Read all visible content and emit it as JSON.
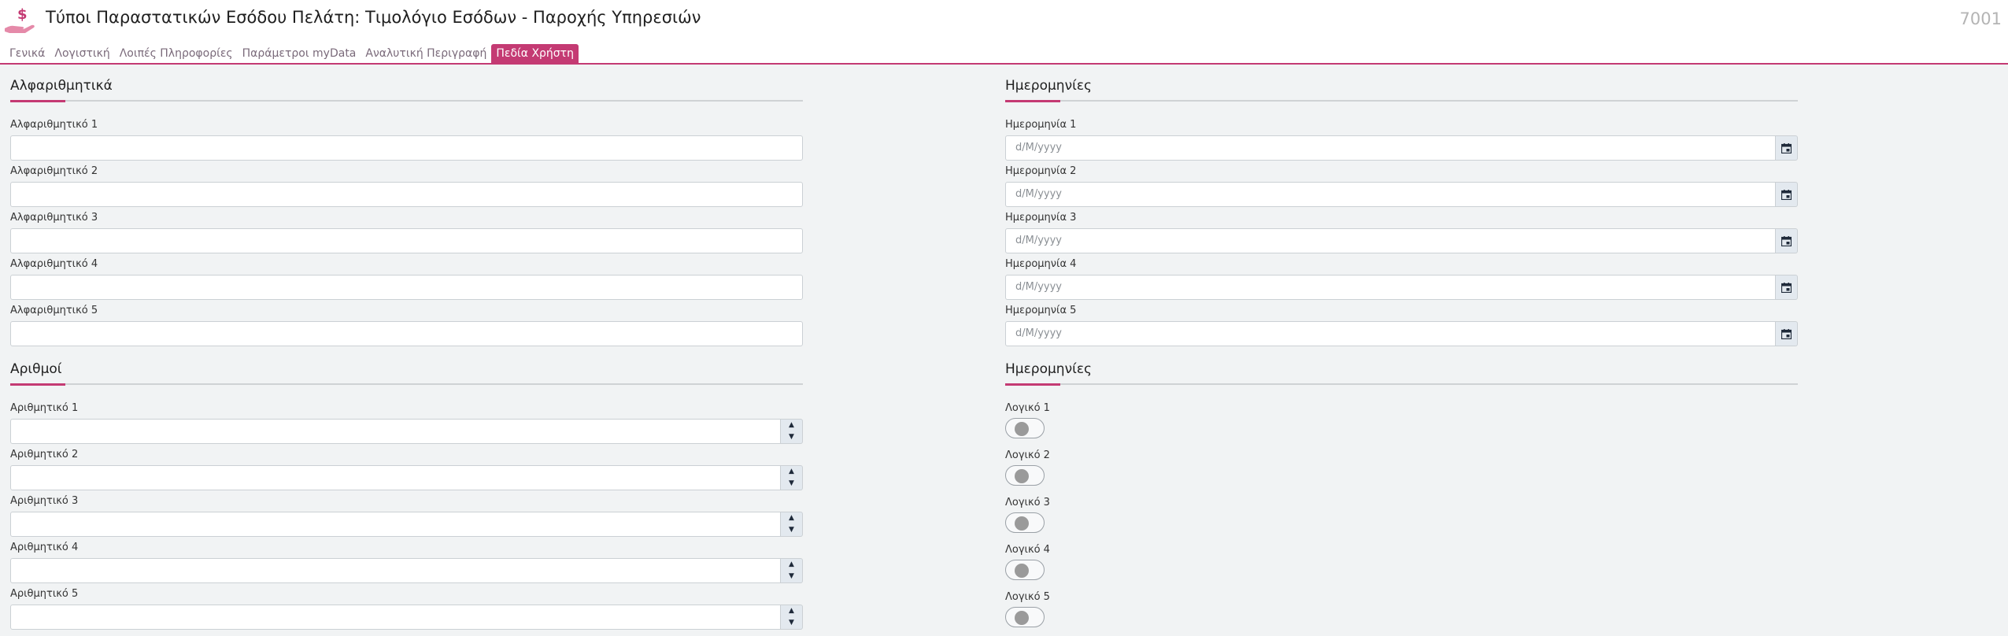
{
  "header": {
    "icon": "hand-dollar-icon",
    "title": "Τύποι Παραστατικών Εσόδου Πελάτη: Τιμολόγιο Εσόδων - Παροχής Υπηρεσιών",
    "record_id": "7001"
  },
  "tabs": [
    {
      "label": "Γενικά",
      "active": false
    },
    {
      "label": "Λογιστική",
      "active": false
    },
    {
      "label": "Λοιπές Πληροφορίες",
      "active": false
    },
    {
      "label": "Παράμετροι myData",
      "active": false
    },
    {
      "label": "Αναλυτική Περιγραφή",
      "active": false
    },
    {
      "label": "Πεδία Χρήστη",
      "active": true
    }
  ],
  "colors": {
    "accent": "#c43a73",
    "background": "#f1f3f4"
  },
  "alpha_section": {
    "title": "Αλφαριθμητικά",
    "fields": [
      {
        "label": "Αλφαριθμητικό 1",
        "value": ""
      },
      {
        "label": "Αλφαριθμητικό 2",
        "value": ""
      },
      {
        "label": "Αλφαριθμητικό 3",
        "value": ""
      },
      {
        "label": "Αλφαριθμητικό 4",
        "value": ""
      },
      {
        "label": "Αλφαριθμητικό 5",
        "value": ""
      }
    ]
  },
  "numbers_section": {
    "title": "Αριθμοί",
    "spin_up": "▲",
    "spin_down": "▼",
    "fields": [
      {
        "label": "Αριθμητικό 1",
        "value": ""
      },
      {
        "label": "Αριθμητικό 2",
        "value": ""
      },
      {
        "label": "Αριθμητικό 3",
        "value": ""
      },
      {
        "label": "Αριθμητικό 4",
        "value": ""
      },
      {
        "label": "Αριθμητικό 5",
        "value": ""
      }
    ]
  },
  "dates_section": {
    "title": "Ημερομηνίες",
    "placeholder": "d/M/yyyy",
    "button_icon": "calendar-icon",
    "fields": [
      {
        "label": "Ημερομηνία 1",
        "value": ""
      },
      {
        "label": "Ημερομηνία 2",
        "value": ""
      },
      {
        "label": "Ημερομηνία 3",
        "value": ""
      },
      {
        "label": "Ημερομηνία 4",
        "value": ""
      },
      {
        "label": "Ημερομηνία 5",
        "value": ""
      }
    ]
  },
  "booleans_section": {
    "title": "Ημερομηνίες",
    "fields": [
      {
        "label": "Λογικό 1",
        "checked": false
      },
      {
        "label": "Λογικό 2",
        "checked": false
      },
      {
        "label": "Λογικό 3",
        "checked": false
      },
      {
        "label": "Λογικό 4",
        "checked": false
      },
      {
        "label": "Λογικό 5",
        "checked": false
      }
    ]
  }
}
